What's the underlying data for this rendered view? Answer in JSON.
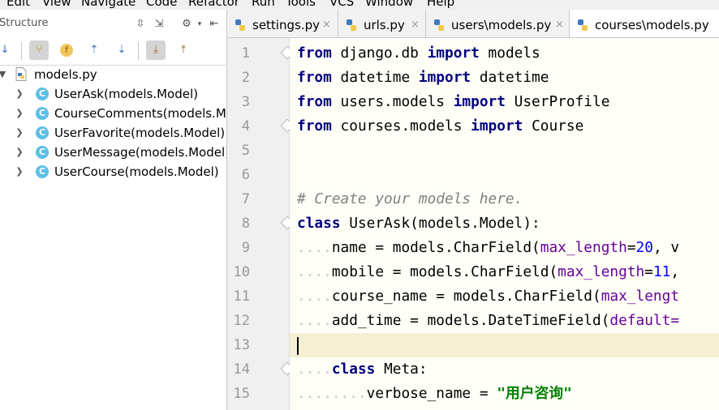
{
  "menu": [
    "Edit",
    "View",
    "Navigate",
    "Code",
    "Refactor",
    "Run",
    "Tools",
    "VCS",
    "Window",
    "Help"
  ],
  "structure": {
    "title": "Structure",
    "file": "models.py",
    "classes": [
      "UserAsk(models.Model)",
      "CourseComments(models.Model)",
      "UserFavorite(models.Model)",
      "UserMessage(models.Model)",
      "UserCourse(models.Model)"
    ],
    "class_icon_letter": "C"
  },
  "tabs": [
    {
      "label": "settings.py",
      "close": "×"
    },
    {
      "label": "urls.py",
      "close": "×"
    },
    {
      "label": "users\\models.py",
      "close": "×"
    },
    {
      "label": "courses\\models.py",
      "close": "×"
    }
  ],
  "editor": {
    "line_numbers": [
      "1",
      "2",
      "3",
      "4",
      "5",
      "6",
      "7",
      "8",
      "9",
      "10",
      "11",
      "12",
      "13",
      "14",
      "15"
    ],
    "current_line": "13",
    "lines": [
      [
        {
          "t": "from",
          "c": "kw"
        },
        {
          "t": " django.db ",
          "c": ""
        },
        {
          "t": "import",
          "c": "kw"
        },
        {
          "t": " models",
          "c": ""
        }
      ],
      [
        {
          "t": "from",
          "c": "kw"
        },
        {
          "t": " datetime ",
          "c": ""
        },
        {
          "t": "import",
          "c": "kw"
        },
        {
          "t": " datetime",
          "c": ""
        }
      ],
      [
        {
          "t": "from",
          "c": "kw"
        },
        {
          "t": " users.models ",
          "c": ""
        },
        {
          "t": "import",
          "c": "kw"
        },
        {
          "t": " UserProfile",
          "c": ""
        }
      ],
      [
        {
          "t": "from",
          "c": "kw"
        },
        {
          "t": " courses.models ",
          "c": ""
        },
        {
          "t": "import",
          "c": "kw"
        },
        {
          "t": " Course",
          "c": ""
        }
      ],
      [],
      [],
      [
        {
          "t": "# Create your models here.",
          "c": "cm"
        }
      ],
      [
        {
          "t": "class",
          "c": "kw"
        },
        {
          "t": " UserAsk(models.Model):",
          "c": ""
        }
      ],
      [
        {
          "t": "....",
          "c": "ws"
        },
        {
          "t": "name = models.CharField(",
          "c": ""
        },
        {
          "t": "max_length",
          "c": "pr"
        },
        {
          "t": "=",
          "c": ""
        },
        {
          "t": "20",
          "c": "nm"
        },
        {
          "t": ", v",
          "c": ""
        }
      ],
      [
        {
          "t": "....",
          "c": "ws"
        },
        {
          "t": "mobile = models.CharField(",
          "c": ""
        },
        {
          "t": "max_length",
          "c": "pr"
        },
        {
          "t": "=",
          "c": ""
        },
        {
          "t": "11",
          "c": "nm"
        },
        {
          "t": ",",
          "c": ""
        }
      ],
      [
        {
          "t": "....",
          "c": "ws"
        },
        {
          "t": "course_name = models.CharField(",
          "c": ""
        },
        {
          "t": "max_lengt",
          "c": "pr"
        }
      ],
      [
        {
          "t": "....",
          "c": "ws"
        },
        {
          "t": "add_time = models.DateTimeField(",
          "c": ""
        },
        {
          "t": "default=",
          "c": "pr"
        }
      ],
      [],
      [
        {
          "t": "....",
          "c": "ws"
        },
        {
          "t": "class",
          "c": "kw"
        },
        {
          "t": " Meta:",
          "c": ""
        }
      ],
      [
        {
          "t": "........",
          "c": "ws"
        },
        {
          "t": "verbose_name = ",
          "c": ""
        },
        {
          "t": "\"用户咨询\"",
          "c": "st"
        }
      ]
    ]
  }
}
